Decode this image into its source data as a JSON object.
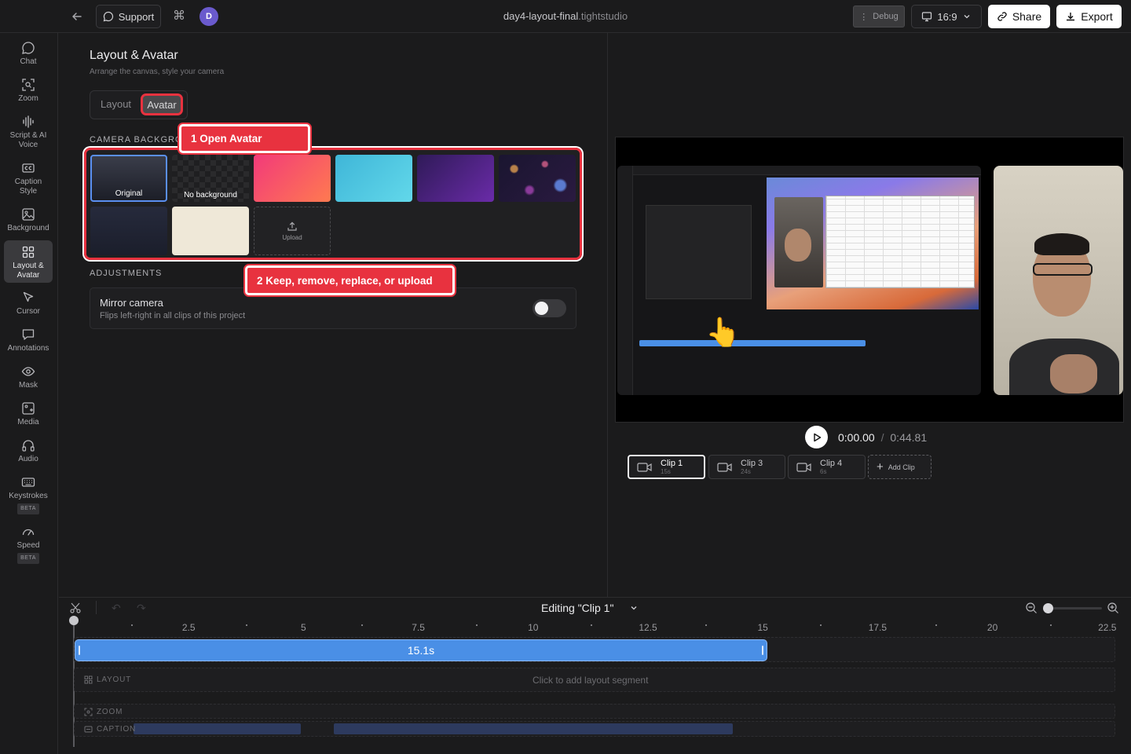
{
  "topbar": {
    "support_label": "Support",
    "avatar_letter": "D",
    "filename": "day4-layout-final",
    "extension": ".tightstudio",
    "debug_label": "Debug",
    "aspect_label": "16:9",
    "share_label": "Share",
    "export_label": "Export"
  },
  "sidebar": {
    "items": [
      {
        "label": "Chat"
      },
      {
        "label": "Zoom"
      },
      {
        "label": "Script & AI Voice"
      },
      {
        "label": "Caption Style"
      },
      {
        "label": "Background"
      },
      {
        "label": "Layout & Avatar"
      },
      {
        "label": "Cursor"
      },
      {
        "label": "Annotations"
      },
      {
        "label": "Mask"
      },
      {
        "label": "Media"
      },
      {
        "label": "Audio"
      },
      {
        "label": "Keystrokes",
        "badge": "BETA"
      },
      {
        "label": "Speed",
        "badge": "BETA"
      }
    ]
  },
  "panel": {
    "title": "Layout & Avatar",
    "subtitle": "Arrange the canvas, style your camera",
    "tabs": [
      "Layout",
      "Avatar"
    ],
    "active_tab": "Avatar",
    "camera_bg_heading": "CAMERA BACKGRO",
    "swatches": {
      "original": "Original",
      "none": "No background",
      "upload": "Upload"
    },
    "adjustments_heading": "ADJUSTMENTS",
    "mirror": {
      "title": "Mirror camera",
      "desc": "Flips left-right in all clips of this project",
      "enabled": false
    }
  },
  "callouts": {
    "one": "1 Open Avatar",
    "two": "2 Keep, remove, replace, or upload"
  },
  "player": {
    "current_time": "0:00.00",
    "separator": "/",
    "duration": "0:44.81"
  },
  "clips": [
    {
      "name": "Clip 1",
      "length": "15s"
    },
    {
      "name": "Clip 3",
      "length": "24s"
    },
    {
      "name": "Clip 4",
      "length": "6s"
    }
  ],
  "add_clip_label": "Add Clip",
  "timeline": {
    "editing_label": "Editing \"Clip 1\"",
    "ticks": [
      "2.5",
      "5",
      "7.5",
      "10",
      "12.5",
      "15",
      "17.5",
      "20",
      "22.5"
    ],
    "clip_bar_label": "15.1s",
    "layout_track_label": "LAYOUT",
    "layout_placeholder": "Click to add layout segment",
    "zoom_track_label": "ZOOM",
    "caption_track_label": "CAPTION"
  },
  "colors": {
    "accent_blue": "#4a8fe6",
    "callout_red": "#e8323f",
    "avatar_purple": "#6a5acd"
  }
}
